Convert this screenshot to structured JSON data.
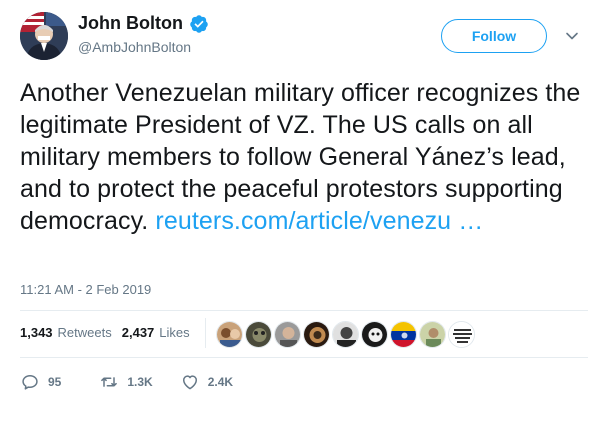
{
  "author": {
    "display_name": "John Bolton",
    "handle": "@AmbJohnBolton",
    "verified": true
  },
  "header": {
    "follow_label": "Follow"
  },
  "tweet": {
    "text": "Another Venezuelan military officer recognizes the legitimate President of VZ. The US calls on all military members to follow General Yánez’s lead, and to protect the peaceful protestors supporting democracy.",
    "link_text": "reuters.com/article/venezu …",
    "timestamp": "11:21 AM - 2 Feb 2019"
  },
  "stats": {
    "retweets_count": "1,343",
    "retweets_label": "Retweets",
    "likes_count": "2,437",
    "likes_label": "Likes",
    "liker_avatar_count": 9
  },
  "actions": {
    "reply_count": "95",
    "retweet_count": "1.3K",
    "like_count": "2.4K"
  },
  "colors": {
    "accent": "#1da1f2",
    "muted": "#657786",
    "text": "#14171a"
  }
}
